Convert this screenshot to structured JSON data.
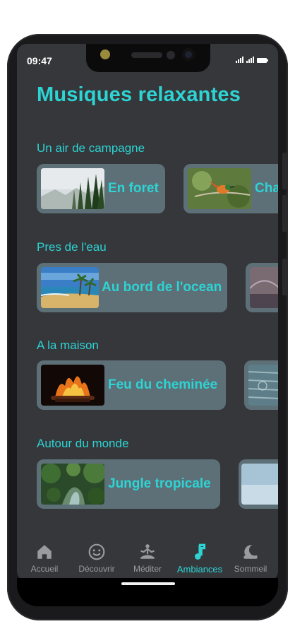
{
  "status": {
    "time": "09:47"
  },
  "page": {
    "title": "Musiques relaxantes"
  },
  "sections": [
    {
      "title": "Un air de campagne",
      "cards": [
        {
          "label": "En foret"
        },
        {
          "label": "Cha"
        }
      ]
    },
    {
      "title": "Pres de l'eau",
      "cards": [
        {
          "label": "Au bord de l'ocean"
        }
      ]
    },
    {
      "title": "A la maison",
      "cards": [
        {
          "label": "Feu du cheminée"
        }
      ]
    },
    {
      "title": "Autour du monde",
      "cards": [
        {
          "label": "Jungle tropicale"
        }
      ]
    }
  ],
  "nav": [
    {
      "label": "Accueil",
      "icon": "home-icon"
    },
    {
      "label": "Découvrir",
      "icon": "smiley-icon"
    },
    {
      "label": "Méditer",
      "icon": "meditation-icon"
    },
    {
      "label": "Ambiances",
      "icon": "music-note-icon",
      "active": true
    },
    {
      "label": "Sommeil",
      "icon": "moon-sleep-icon"
    }
  ],
  "colors": {
    "accent": "#2ed3d3",
    "background": "#35373b",
    "card": "#5d6f77",
    "inactive": "#9a9b9e"
  }
}
